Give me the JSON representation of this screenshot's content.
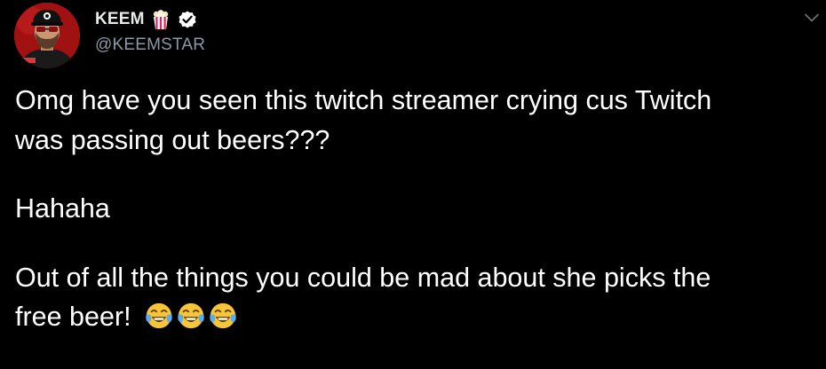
{
  "tweet": {
    "display_name": "KEEM",
    "handle": "@KEEMSTAR",
    "name_badges": [
      "popcorn-icon",
      "verified-badge-icon"
    ],
    "menu_icon": "chevron-down-icon",
    "paragraphs": [
      {
        "lines": [
          "Omg have you seen this twitch streamer crying cus Twitch",
          "was passing out beers???"
        ]
      },
      {
        "lines": [
          "Hahaha"
        ]
      },
      {
        "lines": [
          "Out of all the things you could be mad about she picks the",
          "free beer!"
        ]
      }
    ],
    "trailing_emojis": [
      "tears-of-joy-emoji",
      "tears-of-joy-emoji",
      "tears-of-joy-emoji"
    ]
  },
  "colors": {
    "background": "#000000",
    "text": "#ffffff",
    "handle": "#8b98a5",
    "verified_badge": "#ffffff"
  }
}
